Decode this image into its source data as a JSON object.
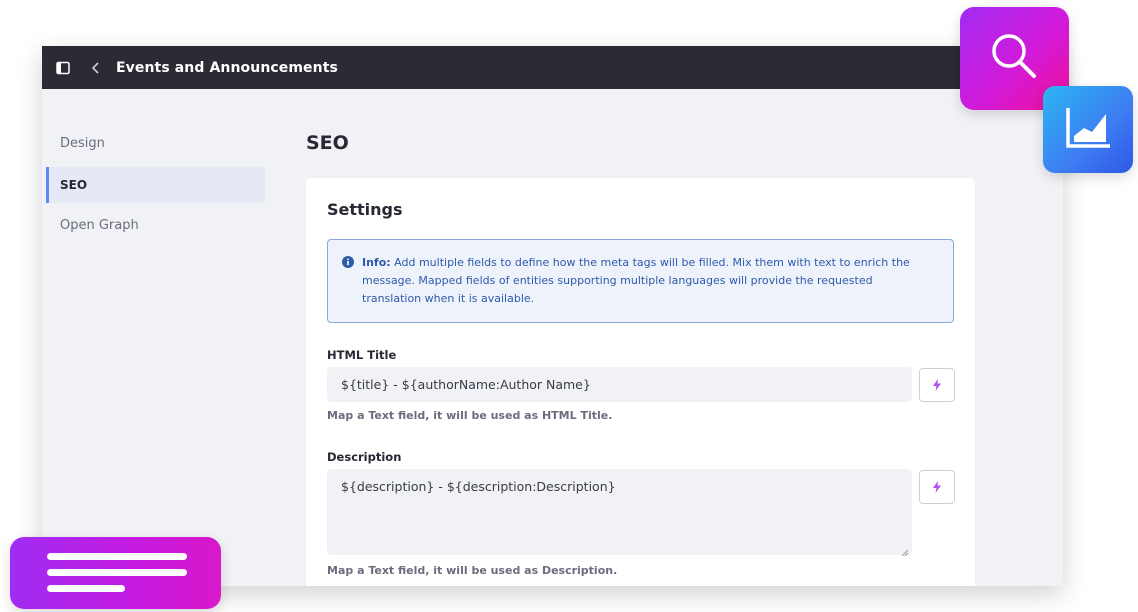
{
  "topbar": {
    "title": "Events and Announcements",
    "icons": [
      "panel-icon",
      "chevron-left-icon"
    ]
  },
  "sidebar": {
    "items": [
      {
        "label": "Design",
        "active": false
      },
      {
        "label": "SEO",
        "active": true
      },
      {
        "label": "Open Graph",
        "active": false
      }
    ]
  },
  "main": {
    "title": "SEO",
    "card": {
      "title": "Settings",
      "info": {
        "label": "Info:",
        "text": "Add multiple fields to define how the meta tags will be filled. Mix them with text to enrich the message. Mapped fields of entities supporting multiple languages will provide the requested translation when it is available."
      },
      "html_title": {
        "label": "HTML Title",
        "value": "${title} - ${authorName:Author Name}",
        "help": "Map a Text field, it will be used as HTML Title."
      },
      "description": {
        "label": "Description",
        "value": "${description} -  ${description:Description}",
        "help": "Map a Text field, it will be used as Description."
      }
    }
  },
  "colors": {
    "topbar_bg": "#2a2b33",
    "accent": "#5e8bf2",
    "info_text": "#2e5aac",
    "map_icon": "#b34ef0",
    "deco_search": "#d11ad9",
    "deco_chart": "#3d7cf2",
    "deco_doc": "#b422e6"
  }
}
